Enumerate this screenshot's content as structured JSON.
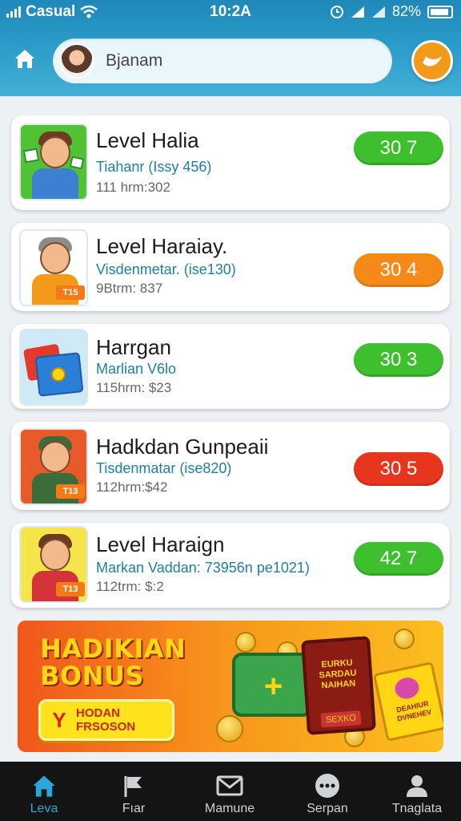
{
  "status_bar": {
    "carrier": "Casual",
    "time": "10:2A",
    "battery": "82%"
  },
  "header": {
    "search_text": "Bjanam"
  },
  "levels": [
    {
      "title": "Level Halia",
      "subtitle": "Tiahanr (Issy 456)",
      "meta": "111 hrm:302",
      "score": "30 7",
      "score_color": "#3dbf2e"
    },
    {
      "title": "Level Haraiay.",
      "subtitle": "Visdenmetar. (ise130)",
      "meta": "9Btrm: 837",
      "score": "30 4",
      "score_color": "#f58a18"
    },
    {
      "title": "Harrgan",
      "subtitle": "Marlian V6lo",
      "meta": "115hrm: $23",
      "score": "30 3",
      "score_color": "#3dbf2e"
    },
    {
      "title": "Hadkdan Gunpeaii",
      "subtitle": "Tisdenmatar (ise820)",
      "meta": "112hrm:$42",
      "score": "30 5",
      "score_color": "#e8361e"
    },
    {
      "title": "Level Haraign",
      "subtitle": "Markan Vaddan: 73956n pe1021)",
      "meta": "112trm: $:2",
      "score": "42 7",
      "score_color": "#3dbf2e"
    }
  ],
  "thumb_badges": [
    "T15",
    "T13",
    "T13"
  ],
  "bonus": {
    "title_line1": "HADIKIAN",
    "title_line2": "BONUS",
    "button_icon": "Y",
    "button_line1": "HODAN",
    "button_line2": "FRSOSON",
    "book_text": "EURKU SARDAU NAIHAN",
    "book_label": "SEXKO",
    "card_text": "DEAHIUR DVNEHEV"
  },
  "nav": [
    {
      "label": "Leva",
      "icon": "home-icon",
      "active": true
    },
    {
      "label": "Fıar",
      "icon": "flag-icon",
      "active": false
    },
    {
      "label": "Mamune",
      "icon": "mail-icon",
      "active": false
    },
    {
      "label": "Serpan",
      "icon": "more-icon",
      "active": false
    },
    {
      "label": "Tnaglata",
      "icon": "profile-icon",
      "active": false
    }
  ]
}
